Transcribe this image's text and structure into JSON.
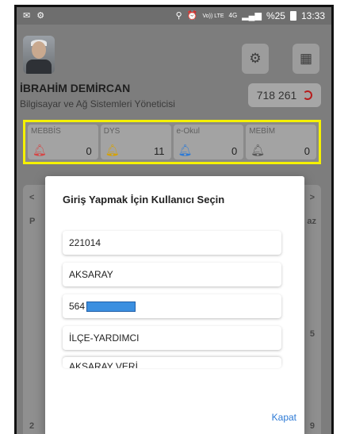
{
  "status_bar": {
    "left_icons": [
      "mail-icon",
      "settings-gear-icon"
    ],
    "right_icons": [
      "location-icon",
      "alarm-icon",
      "volte-icon",
      "4g-icon",
      "signal-icon",
      "battery-icon"
    ],
    "volte": "Vo)) LTE",
    "network": "4G",
    "battery": "%25",
    "time": "13:33"
  },
  "profile": {
    "name": "İBRAHİM DEMİRCAN",
    "title": "Bilgisayar ve Ağ Sistemleri Yöneticisi",
    "score": "718 261"
  },
  "counters": [
    {
      "name": "MEBBİS",
      "value": "0",
      "bell_color": "#d64545"
    },
    {
      "name": "DYS",
      "value": "11",
      "bell_color": "#f0c419"
    },
    {
      "name": "e-Okul",
      "value": "0",
      "bell_color": "#2d7ad6"
    },
    {
      "name": "MEBİM",
      "value": "0",
      "bell_color": "#666666"
    }
  ],
  "background_fragments": {
    "left_nav": "<",
    "right_nav": ">",
    "letter_p": "P",
    "letters_az": "az",
    "num_2": "2",
    "num_9": "9",
    "num_5": "5"
  },
  "dialog": {
    "title": "Giriş Yapmak İçin Kullanıcı Seçin",
    "options": [
      "221014",
      "AKSARAY",
      "564",
      "İLÇE-YARDIMCI",
      "AKSARAY VERİ"
    ],
    "close_button": "Kapat"
  },
  "colors": {
    "highlight_border": "#f5f100",
    "accent": "#2d7ad6",
    "mask": "#3b8fe0"
  }
}
